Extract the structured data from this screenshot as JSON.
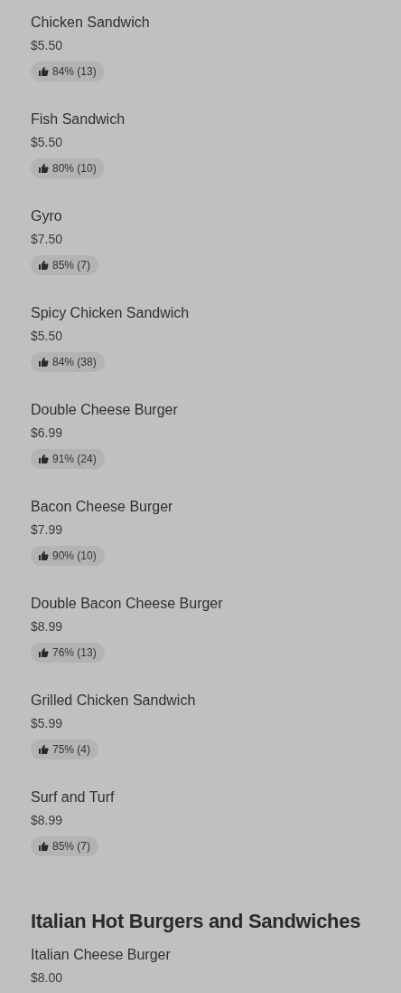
{
  "sections": [
    {
      "items": [
        {
          "name": "Chicken Sandwich",
          "price": "$5.50",
          "rating": "84% (13)"
        },
        {
          "name": "Fish Sandwich",
          "price": "$5.50",
          "rating": "80% (10)"
        },
        {
          "name": "Gyro",
          "price": "$7.50",
          "rating": "85% (7)"
        },
        {
          "name": "Spicy Chicken Sandwich",
          "price": "$5.50",
          "rating": "84% (38)"
        },
        {
          "name": "Double Cheese Burger",
          "price": "$6.99",
          "rating": "91% (24)"
        },
        {
          "name": "Bacon Cheese Burger",
          "price": "$7.99",
          "rating": "90% (10)"
        },
        {
          "name": "Double Bacon Cheese Burger",
          "price": "$8.99",
          "rating": "76% (13)"
        },
        {
          "name": "Grilled Chicken Sandwich",
          "price": "$5.99",
          "rating": "75% (4)"
        },
        {
          "name": "Surf and Turf",
          "price": "$8.99",
          "rating": "85% (7)"
        }
      ]
    },
    {
      "title": "Italian Hot Burgers and Sandwiches",
      "items": [
        {
          "name": "Italian Cheese Burger",
          "price": "$8.00"
        }
      ]
    }
  ]
}
